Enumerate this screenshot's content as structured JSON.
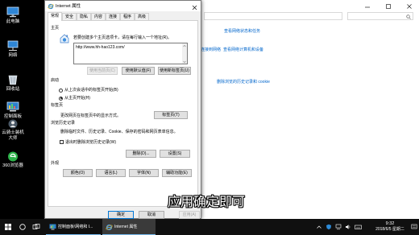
{
  "desktop": {
    "icons": [
      {
        "label": "此电脑",
        "icon": "computer-icon"
      },
      {
        "label": "网络",
        "icon": "network-icon"
      },
      {
        "label": "回收站",
        "icon": "recycle-bin-icon"
      },
      {
        "label": "控制面板",
        "icon": "control-panel-icon"
      },
      {
        "label": "云骑士装机大师",
        "icon": "yunqishi-installer-icon"
      },
      {
        "label": "360浏览器",
        "icon": "360-browser-icon"
      }
    ]
  },
  "control_panel": {
    "links": [
      "查看网络状态和任务",
      "连接到网络",
      "查看网络计算机和设备",
      "删除浏览的历史记录和 cookie"
    ]
  },
  "dialog": {
    "title": "Internet 属性",
    "tabs": [
      "常规",
      "安全",
      "隐私",
      "内容",
      "连接",
      "程序",
      "高级"
    ],
    "active_tab": "常规",
    "home": {
      "group_label": "主页",
      "instruction": "若要创建多个主页选项卡，请在每行输入一个地址(R)。",
      "url": "http://www.hh-hao123.com/",
      "use_current": "使用当前页(C)",
      "use_default": "使用默认值(F)",
      "use_new_tab": "使用新标签页(U)"
    },
    "startup": {
      "group_label": "启动",
      "option_last_session": "从上次会话中的标签页开始(B)",
      "option_home": "从主页开始(H)",
      "selected": "option_home"
    },
    "tabs_section": {
      "group_label": "标签页",
      "description": "更改网页在标签页中的显示方式。",
      "button": "标签页(T)"
    },
    "history": {
      "group_label": "浏览历史记录",
      "description": "删除临时文件、历史记录、Cookie、保存的密码和网页表单信息。",
      "checkbox": "退出时删除浏览历史记录(W)",
      "checked": false,
      "delete_button": "删除(D)...",
      "settings_button": "设置(S)"
    },
    "appearance": {
      "group_label": "外观",
      "colors": "颜色(O)",
      "languages": "语言(L)",
      "fonts": "字体(N)",
      "accessibility": "辅助功能(E)"
    },
    "footer": {
      "ok": "确定",
      "cancel": "取消",
      "apply": "应用(A)"
    }
  },
  "subtitle": "应用确定即可",
  "taskbar": {
    "apps": [
      {
        "label": "控制面板\\网络和 I...",
        "icon": "control-panel-icon",
        "active": false
      },
      {
        "label": "Internet 属性",
        "icon": "internet-explorer-icon",
        "active": true
      }
    ],
    "time": "9:32",
    "date": "2018/6/5 星期二"
  },
  "colors": {
    "accent": "#0078d7",
    "link": "#0066cc",
    "taskbar": "#101010",
    "desktop": "#000000"
  }
}
